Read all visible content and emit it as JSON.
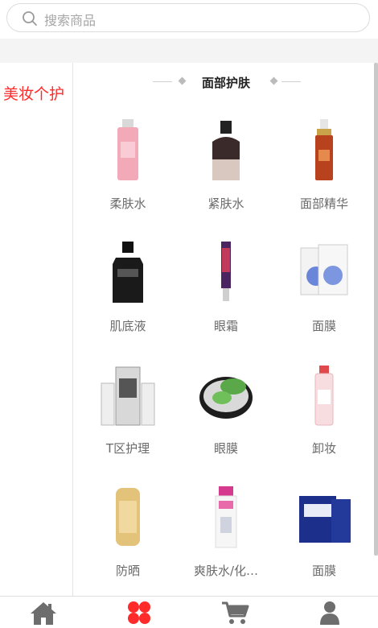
{
  "search": {
    "placeholder": "搜索商品",
    "icon": "search-icon"
  },
  "sidebar": {
    "items": [
      {
        "label": "美妆个护",
        "active": true
      }
    ]
  },
  "section": {
    "title": "面部护肤"
  },
  "products": [
    {
      "label": "柔肤水",
      "icon": "toner-bottle-pink"
    },
    {
      "label": "紧肤水",
      "icon": "firming-water-bottle"
    },
    {
      "label": "面部精华",
      "icon": "serum-dropper-bottle"
    },
    {
      "label": "肌底液",
      "icon": "black-essence-bottle"
    },
    {
      "label": "眼霜",
      "icon": "eye-cream-tube"
    },
    {
      "label": "面膜",
      "icon": "face-mask-packs"
    },
    {
      "label": "T区护理",
      "icon": "t-zone-kit"
    },
    {
      "label": "眼膜",
      "icon": "eye-mask-jar"
    },
    {
      "label": "卸妆",
      "icon": "micellar-water-bottle"
    },
    {
      "label": "防晒",
      "icon": "sunscreen-bottle"
    },
    {
      "label": "爽肤水/化…",
      "icon": "lotion-bottle"
    },
    {
      "label": "面膜",
      "icon": "mask-box"
    }
  ],
  "tabbar": {
    "tabs": [
      {
        "icon": "home-icon",
        "active": false
      },
      {
        "icon": "category-icon",
        "active": true
      },
      {
        "icon": "cart-icon",
        "active": false
      },
      {
        "icon": "user-icon",
        "active": false
      }
    ]
  },
  "colors": {
    "accent": "#ff2a2a",
    "icon_inactive": "#6d6d6d",
    "placeholder": "#a6a6a6"
  }
}
